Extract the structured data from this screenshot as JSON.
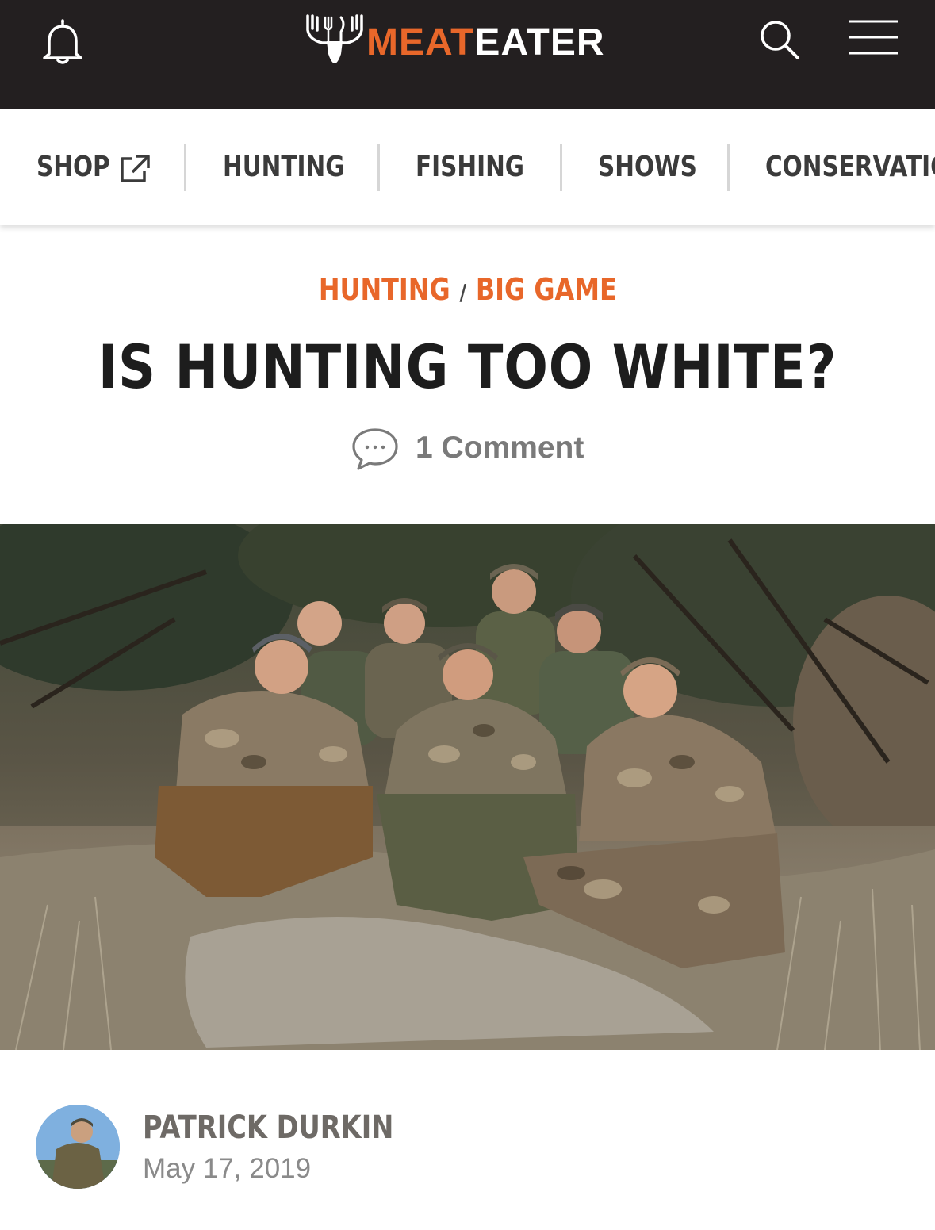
{
  "header": {
    "logo_part1": "MEAT",
    "logo_part2": "EATER",
    "brand_color": "#e8672a",
    "background_color": "#231f20",
    "icons": [
      "bell-icon",
      "search-icon",
      "menu-icon"
    ]
  },
  "nav": {
    "items": [
      {
        "label": "SHOP",
        "icon": "external-link-icon"
      },
      {
        "label": "HUNTING"
      },
      {
        "label": "FISHING"
      },
      {
        "label": "SHOWS"
      },
      {
        "label": "CONSERVATION"
      }
    ]
  },
  "article": {
    "breadcrumb": [
      "HUNTING",
      "BIG GAME"
    ],
    "breadcrumb_separator": "/",
    "title": "IS HUNTING TOO WHITE?",
    "comments_label": "1 Comment",
    "author": "PATRICK DURKIN",
    "date": "May 17, 2019"
  }
}
